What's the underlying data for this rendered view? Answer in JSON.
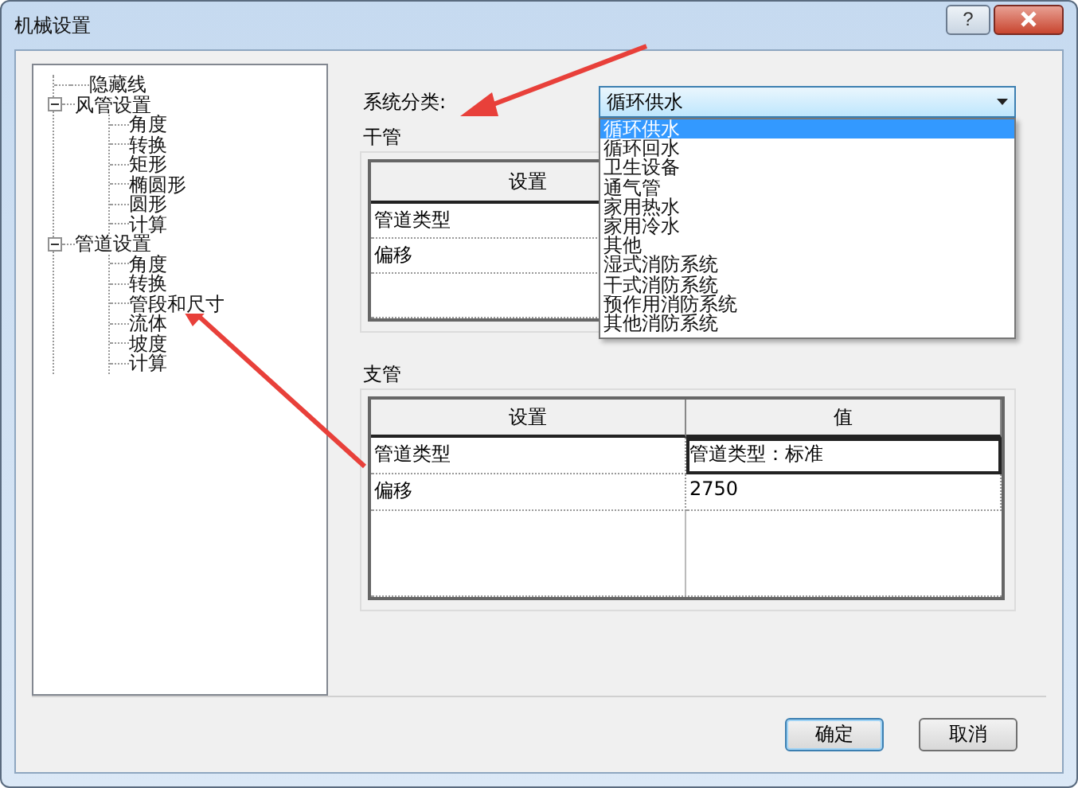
{
  "window": {
    "title": "机械设置",
    "help_button": "?"
  },
  "tree": [
    {
      "label": "隐藏线"
    },
    {
      "label": "风管设置",
      "expanded": true,
      "children": [
        {
          "label": "角度"
        },
        {
          "label": "转换"
        },
        {
          "label": "矩形"
        },
        {
          "label": "椭圆形"
        },
        {
          "label": "圆形"
        },
        {
          "label": "计算"
        }
      ]
    },
    {
      "label": "管道设置",
      "expanded": true,
      "children": [
        {
          "label": "角度"
        },
        {
          "label": "转换"
        },
        {
          "label": "管段和尺寸"
        },
        {
          "label": "流体"
        },
        {
          "label": "坡度"
        },
        {
          "label": "计算"
        }
      ]
    }
  ],
  "system_category": {
    "label": "系统分类:",
    "value": "循环供水",
    "open": true,
    "options": [
      {
        "label": "循环供水",
        "selected": true
      },
      {
        "label": "循环回水",
        "selected": false
      },
      {
        "label": "卫生设备",
        "selected": false
      },
      {
        "label": "通气管",
        "selected": false
      },
      {
        "label": "家用热水",
        "selected": false
      },
      {
        "label": "家用冷水",
        "selected": false
      },
      {
        "label": "其他",
        "selected": false
      },
      {
        "label": "湿式消防系统",
        "selected": false
      },
      {
        "label": "干式消防系统",
        "selected": false
      },
      {
        "label": "预作用消防系统",
        "selected": false
      },
      {
        "label": "其他消防系统",
        "selected": false
      }
    ]
  },
  "main_pipe": {
    "title": "干管",
    "columns": [
      "设置"
    ],
    "rows": [
      {
        "setting": "管道类型"
      },
      {
        "setting": "偏移"
      }
    ]
  },
  "branch_pipe": {
    "title": "支管",
    "columns": [
      "设置",
      "值"
    ],
    "rows": [
      {
        "setting": "管道类型",
        "value": "管道类型：标准",
        "selected": true
      },
      {
        "setting": "偏移",
        "value": "2750",
        "selected": false
      }
    ]
  },
  "buttons": [
    {
      "label": "确定",
      "default": true
    },
    {
      "label": "取消",
      "default": false
    }
  ]
}
